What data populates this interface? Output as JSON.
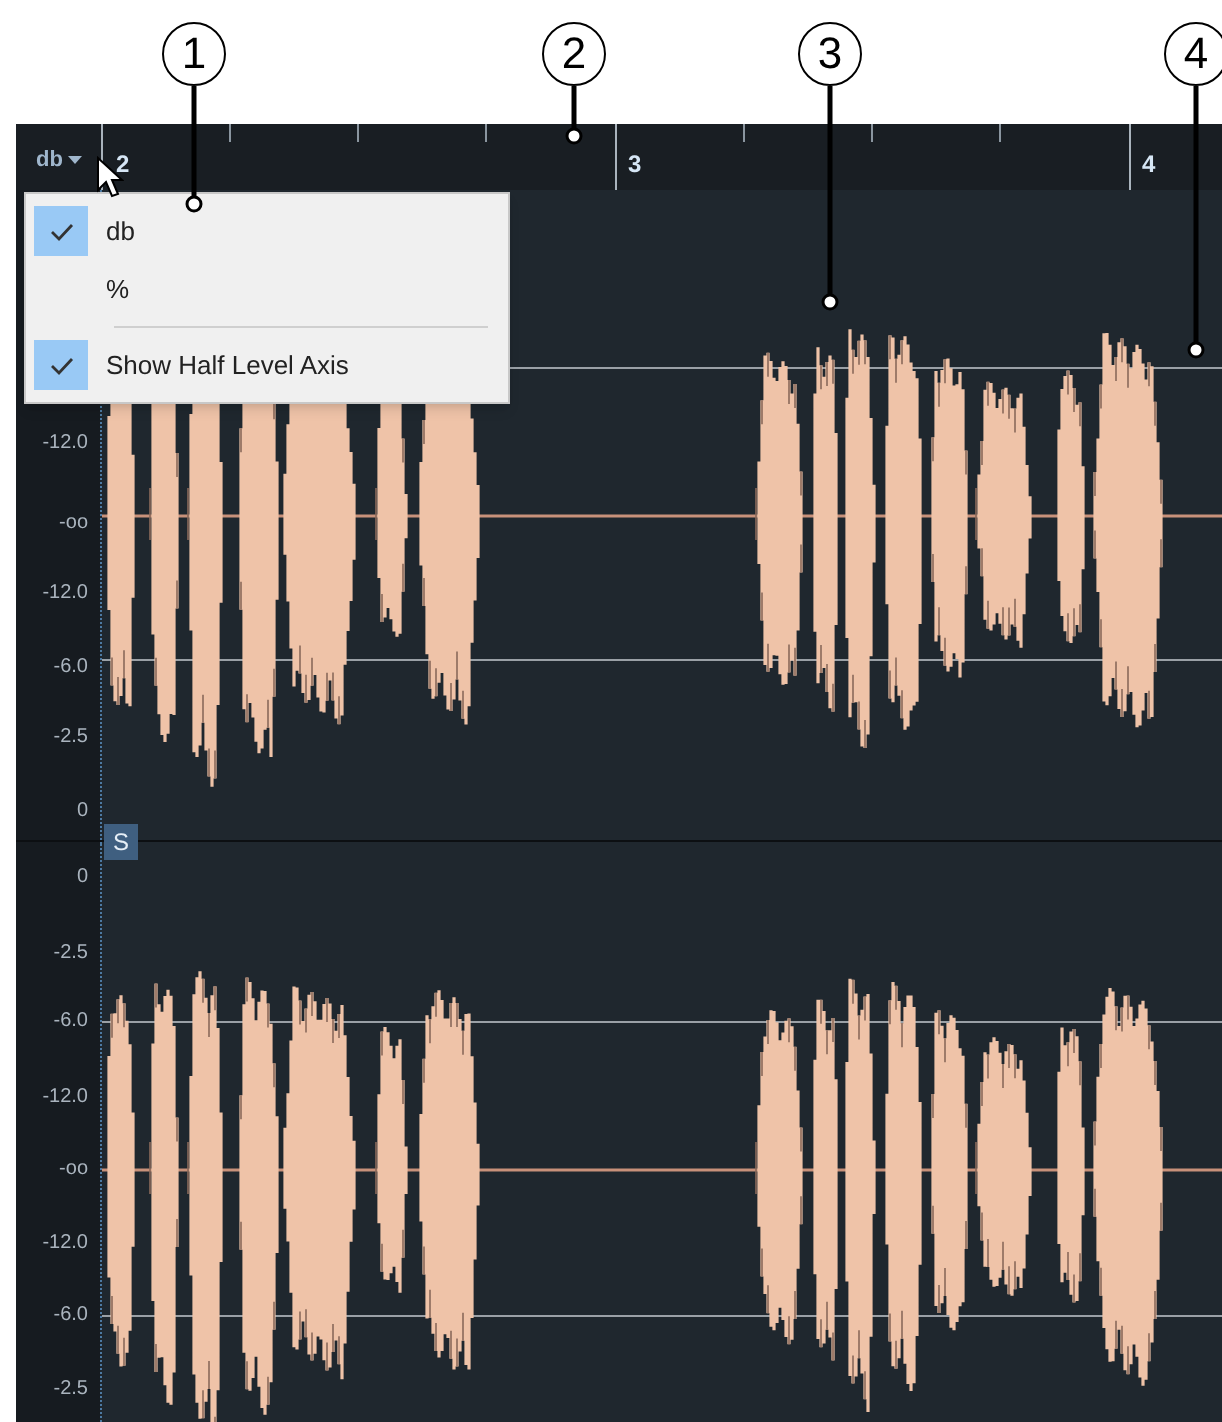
{
  "ruler": {
    "unit_button": "db",
    "bar_numbers": [
      "2",
      "3",
      "4"
    ]
  },
  "unit_menu": {
    "unit_options": [
      {
        "label": "db",
        "checked": true
      },
      {
        "label": "%",
        "checked": false
      }
    ],
    "view_options": [
      {
        "label": "Show Half Level Axis",
        "checked": true
      }
    ]
  },
  "lanes": [
    {
      "axis_labels": [
        "-12.0",
        "-oo",
        "-12.0",
        "-6.0",
        "-2.5",
        "0"
      ]
    },
    {
      "badge": "S",
      "axis_labels": [
        "0",
        "-2.5",
        "-6.0",
        "-12.0",
        "-oo",
        "-12.0",
        "-6.0",
        "-2.5"
      ]
    }
  ],
  "callouts": [
    "1",
    "2",
    "3",
    "4"
  ]
}
